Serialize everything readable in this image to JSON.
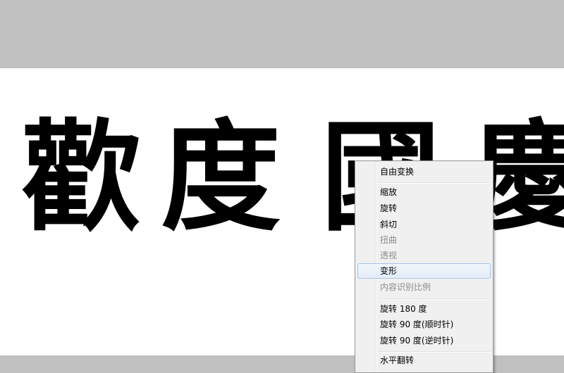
{
  "canvas": {
    "characters": [
      "歡",
      "度",
      "國",
      "慶"
    ]
  },
  "menu": {
    "items": [
      {
        "label": "自由变换",
        "enabled": true
      },
      {
        "label": "缩放",
        "enabled": true
      },
      {
        "label": "旋转",
        "enabled": true
      },
      {
        "label": "斜切",
        "enabled": true
      },
      {
        "label": "扭曲",
        "enabled": false
      },
      {
        "label": "透视",
        "enabled": false
      },
      {
        "label": "变形",
        "enabled": true,
        "highlighted": true
      },
      {
        "label": "内容识别比例",
        "enabled": false
      },
      {
        "label": "旋转 180 度",
        "enabled": true
      },
      {
        "label": "旋转 90 度(顺时针)",
        "enabled": true
      },
      {
        "label": "旋转 90 度(逆时针)",
        "enabled": true
      },
      {
        "label": "水平翻转",
        "enabled": true
      }
    ]
  }
}
